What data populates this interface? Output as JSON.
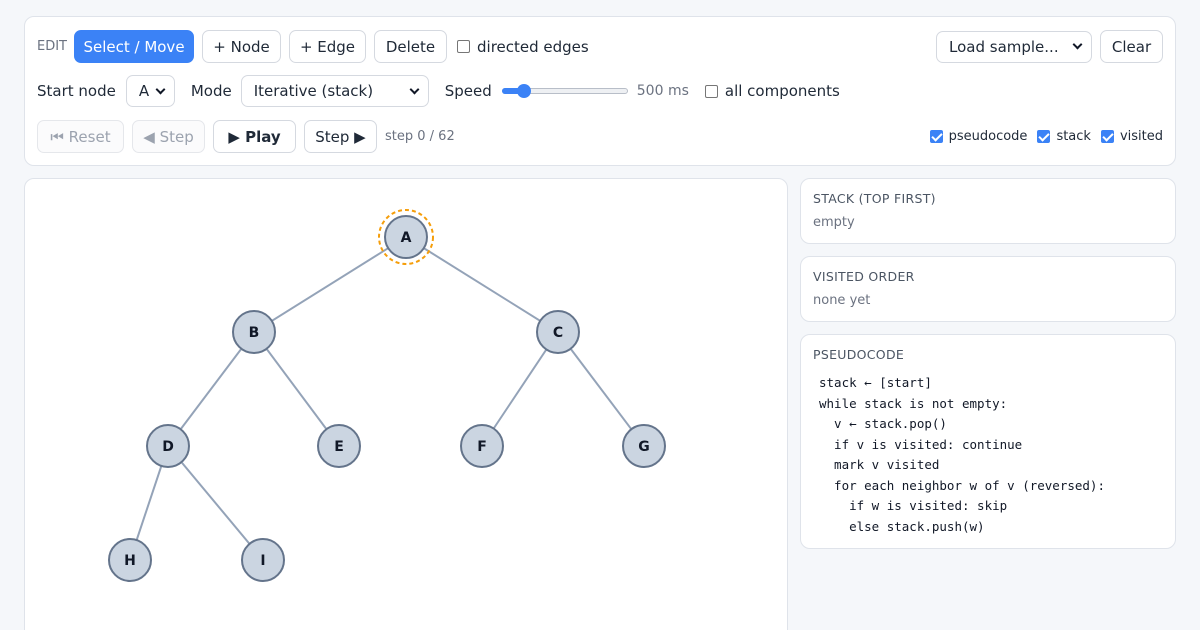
{
  "toolbar": {
    "edit_label": "EDIT",
    "select_move": "Select / Move",
    "add_node": "+ Node",
    "add_edge": "+ Edge",
    "delete": "Delete",
    "directed_edges": "directed edges",
    "directed_checked": false,
    "load_sample": "Load sample...",
    "clear": "Clear",
    "start_node_label": "Start node",
    "start_node_value": "A",
    "mode_label": "Mode",
    "mode_value": "Iterative (stack)",
    "speed_label": "Speed",
    "speed_value": "500 ms",
    "speed_fraction": 0.14,
    "all_components": "all components",
    "all_components_checked": false,
    "reset": "⏮ Reset",
    "step_back": "◀ Step",
    "play": "▶ Play",
    "step_forward": "Step ▶",
    "step_counter": "step 0 / 62",
    "show_pseudocode": "pseudocode",
    "show_stack": "stack",
    "show_visited": "visited",
    "accent_color": "#3b82f6"
  },
  "graph": {
    "nodes": [
      {
        "id": "A",
        "highlight": true
      },
      {
        "id": "B"
      },
      {
        "id": "C"
      },
      {
        "id": "D"
      },
      {
        "id": "E"
      },
      {
        "id": "F"
      },
      {
        "id": "G"
      },
      {
        "id": "H"
      },
      {
        "id": "I"
      }
    ],
    "edges": [
      [
        "A",
        "B"
      ],
      [
        "A",
        "C"
      ],
      [
        "B",
        "D"
      ],
      [
        "B",
        "E"
      ],
      [
        "C",
        "F"
      ],
      [
        "C",
        "G"
      ],
      [
        "D",
        "H"
      ],
      [
        "D",
        "I"
      ]
    ],
    "node_fill": "#cbd5e1",
    "node_stroke": "#64748b",
    "edge_color": "#94a3b8",
    "highlight_color": "#f59e0b"
  },
  "panels": {
    "stack_title": "STACK (TOP FIRST)",
    "stack_value": "empty",
    "visited_title": "VISITED ORDER",
    "visited_value": "none yet",
    "pseudocode_title": "PSEUDOCODE",
    "pseudocode": [
      "stack ← [start]",
      "while stack is not empty:",
      "  v ← stack.pop()",
      "  if v is visited: continue",
      "  mark v visited",
      "  for each neighbor w of v (reversed):",
      "    if w is visited: skip",
      "    else stack.push(w)"
    ]
  }
}
